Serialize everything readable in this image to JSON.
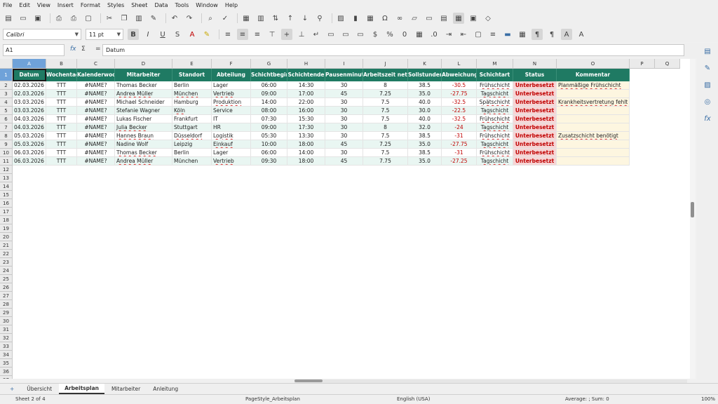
{
  "menu": [
    "File",
    "Edit",
    "View",
    "Insert",
    "Format",
    "Styles",
    "Sheet",
    "Data",
    "Tools",
    "Window",
    "Help"
  ],
  "font_name": "Calibri",
  "font_size": "11 pt",
  "name_box": "A1",
  "formula": "Datum",
  "columns": [
    "A",
    "B",
    "C",
    "D",
    "E",
    "F",
    "G",
    "H",
    "I",
    "J",
    "K",
    "L",
    "M",
    "N",
    "O",
    "P",
    "Q"
  ],
  "headers": [
    "Datum",
    "Wochentag",
    "Kalenderwoche",
    "Mitarbeiter",
    "Standort",
    "Abteilung",
    "Schichtbeginn",
    "Schichtende",
    "Pausenminuten",
    "Arbeitszeit netto",
    "Sollstunden",
    "Abweichung",
    "Schichtart",
    "Status",
    "Kommentar"
  ],
  "rows": [
    [
      "02.03.2026",
      "TTT",
      "#NAME?",
      "Thomas Becker",
      "Berlin",
      "Lager",
      "06:00",
      "14:30",
      "30",
      "8",
      "38.5",
      "-30.5",
      "Frühschicht",
      "Unterbesetzt",
      "Planmäßige Frühschicht"
    ],
    [
      "02.03.2026",
      "TTT",
      "#NAME?",
      "Andrea Müller",
      "München",
      "Vertrieb",
      "09:00",
      "17:00",
      "45",
      "7.25",
      "35.0",
      "-27.75",
      "Tagschicht",
      "Unterbesetzt",
      ""
    ],
    [
      "03.03.2026",
      "TTT",
      "#NAME?",
      "Michael Schneider",
      "Hamburg",
      "Produktion",
      "14:00",
      "22:00",
      "30",
      "7.5",
      "40.0",
      "-32.5",
      "Spätschicht",
      "Unterbesetzt",
      "Krankheitsvertretung fehlt"
    ],
    [
      "03.03.2026",
      "TTT",
      "#NAME?",
      "Stefanie Wagner",
      "Köln",
      "Service",
      "08:00",
      "16:00",
      "30",
      "7.5",
      "30.0",
      "-22.5",
      "Tagschicht",
      "Unterbesetzt",
      ""
    ],
    [
      "04.03.2026",
      "TTT",
      "#NAME?",
      "Lukas Fischer",
      "Frankfurt",
      "IT",
      "07:30",
      "15:30",
      "30",
      "7.5",
      "40.0",
      "-32.5",
      "Frühschicht",
      "Unterbesetzt",
      ""
    ],
    [
      "04.03.2026",
      "TTT",
      "#NAME?",
      "Julia Becker",
      "Stuttgart",
      "HR",
      "09:00",
      "17:30",
      "30",
      "8",
      "32.0",
      "-24",
      "Tagschicht",
      "Unterbesetzt",
      ""
    ],
    [
      "05.03.2026",
      "TTT",
      "#NAME?",
      "Hannes Braun",
      "Düsseldorf",
      "Logistik",
      "05:30",
      "13:30",
      "30",
      "7.5",
      "38.5",
      "-31",
      "Frühschicht",
      "Unterbesetzt",
      "Zusatzschicht benötigt"
    ],
    [
      "05.03.2026",
      "TTT",
      "#NAME?",
      "Nadine Wolf",
      "Leipzig",
      "Einkauf",
      "10:00",
      "18:00",
      "45",
      "7.25",
      "35.0",
      "-27.75",
      "Tagschicht",
      "Unterbesetzt",
      ""
    ],
    [
      "06.03.2026",
      "TTT",
      "#NAME?",
      "Thomas Becker",
      "Berlin",
      "Lager",
      "06:00",
      "14:00",
      "30",
      "7.5",
      "38.5",
      "-31",
      "Frühschicht",
      "Unterbesetzt",
      ""
    ],
    [
      "06.03.2026",
      "TTT",
      "#NAME?",
      "Andrea Müller",
      "München",
      "Vertrieb",
      "09:30",
      "18:00",
      "45",
      "7.75",
      "35.0",
      "-27.25",
      "Tagschicht",
      "Unterbesetzt",
      ""
    ]
  ],
  "tabs": [
    "Übersicht",
    "Arbeitsplan",
    "Mitarbeiter",
    "Anleitung"
  ],
  "tab_add": "+",
  "status": {
    "sheet": "Sheet 2 of 4",
    "page_style": "PageStyle_Arbeitsplan",
    "language": "English (USA)",
    "summary": "Average: ; Sum: 0",
    "zoom": "100%"
  },
  "colors": {
    "header_bg": "#1f7a63",
    "status_bg": "#f6d5d5",
    "negative": "#c00000"
  }
}
